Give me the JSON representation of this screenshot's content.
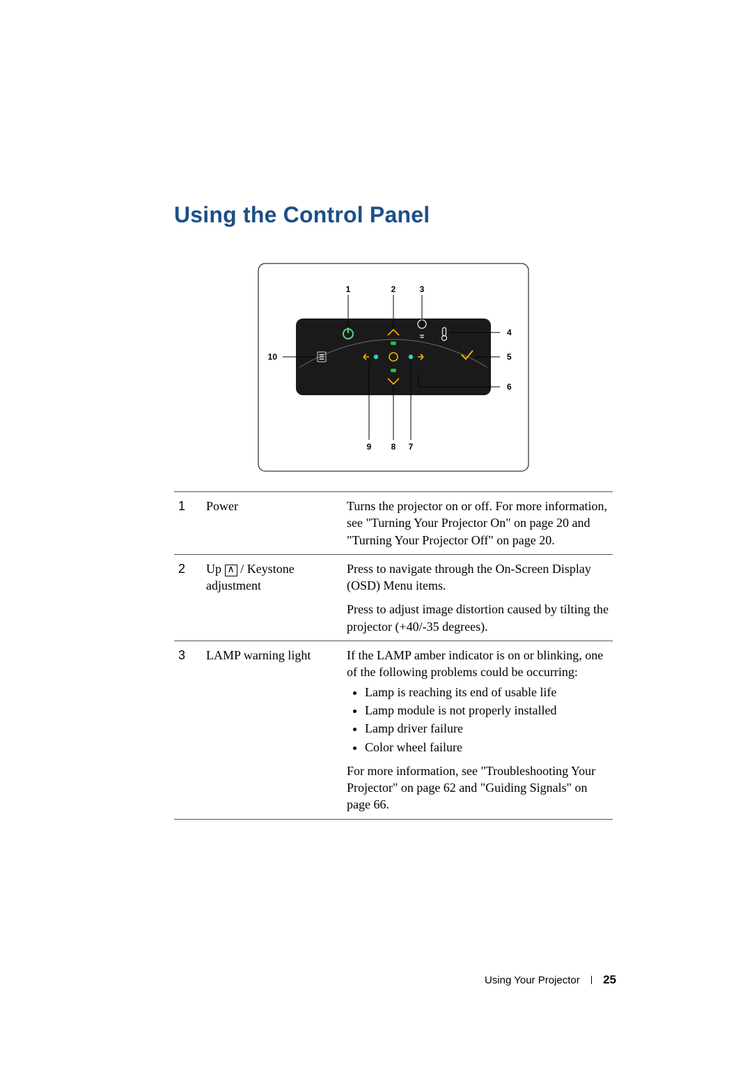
{
  "title": "Using the Control Panel",
  "figure": {
    "callouts": [
      "1",
      "2",
      "3",
      "4",
      "5",
      "6",
      "7",
      "8",
      "9",
      "10"
    ]
  },
  "rows": [
    {
      "num": "1",
      "name_plain": "Power",
      "desc_plain": "Turns the projector on or off. For more information, see \"Turning Your Projector On\" on page 20 and \"Turning Your Projector Off\" on page 20."
    },
    {
      "num": "2",
      "name_prefix": "Up ",
      "name_keycap": "∧",
      "name_suffix": " / Keystone adjustment",
      "desc_parts": [
        "Press to navigate through the On-Screen Display (OSD) Menu items.",
        "Press to adjust image distortion caused by tilting the projector (+40/-35 degrees)."
      ]
    },
    {
      "num": "3",
      "name_plain": "LAMP warning light",
      "desc_lead": "If the LAMP amber indicator is on or blinking, one of the following problems could be occurring:",
      "bullets": [
        "Lamp is reaching its end of usable life",
        "Lamp module is not properly installed",
        "Lamp driver failure",
        "Color wheel failure"
      ],
      "desc_trail": "For more information, see \"Troubleshooting Your Projector\" on page 62 and \"Guiding Signals\" on page 66."
    }
  ],
  "footer": {
    "section": "Using Your Projector",
    "page": "25"
  }
}
